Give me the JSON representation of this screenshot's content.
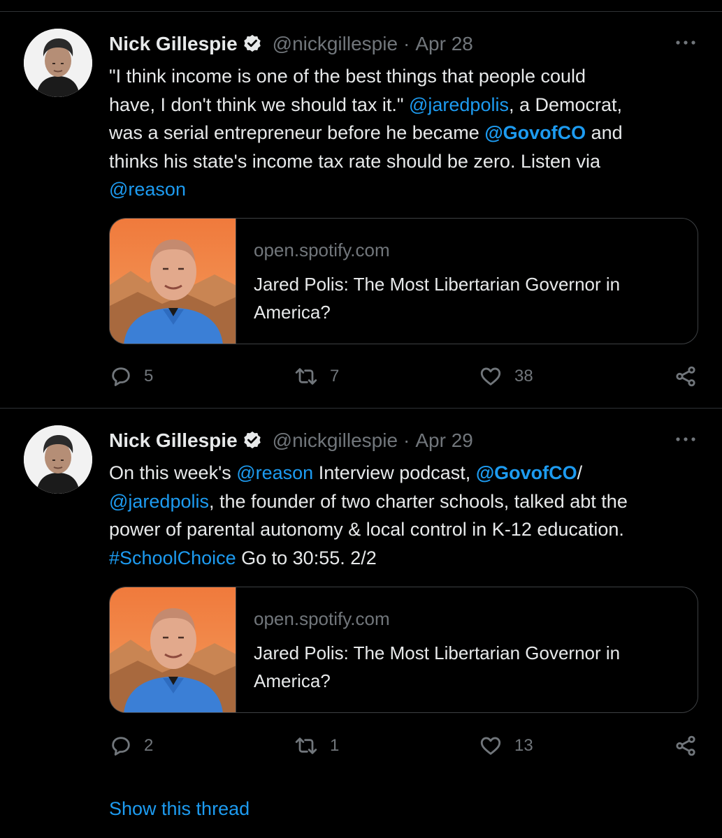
{
  "tweets": [
    {
      "author": "Nick Gillespie",
      "handle": "@nickgillespie",
      "separator": "·",
      "date": "Apr 28",
      "text_segments": [
        {
          "t": "\"I think income is one of the best things that people could",
          "k": "plain"
        },
        {
          "t": "have, I don't think we should tax it.\" ",
          "k": "plain"
        },
        {
          "t": "@jaredpolis",
          "k": "mention"
        },
        {
          "t": ", a Democrat,",
          "k": "plain"
        },
        {
          "t": "was a serial entrepreneur before he became ",
          "k": "plain"
        },
        {
          "t": "@GovofCO",
          "k": "mention-bold"
        },
        {
          "t": " and",
          "k": "plain"
        },
        {
          "t": "thinks his state's income tax rate should be zero. Listen via",
          "k": "plain"
        },
        {
          "t": "@reason",
          "k": "mention"
        }
      ],
      "card": {
        "domain": "open.spotify.com",
        "title": "Jared Polis: The Most Libertarian Governor in America?"
      },
      "counts": {
        "replies": "5",
        "retweets": "7",
        "likes": "38"
      }
    },
    {
      "author": "Nick Gillespie",
      "handle": "@nickgillespie",
      "separator": "·",
      "date": "Apr 29",
      "text_segments": [
        {
          "t": "On this week's ",
          "k": "plain"
        },
        {
          "t": "@reason",
          "k": "mention"
        },
        {
          "t": " Interview podcast, ",
          "k": "plain"
        },
        {
          "t": "@GovofCO",
          "k": "mention-bold"
        },
        {
          "t": "/",
          "k": "plain"
        },
        {
          "t": "@jaredpolis",
          "k": "mention"
        },
        {
          "t": ", the founder of two charter schools, talked abt the",
          "k": "plain"
        },
        {
          "t": "power of parental autonomy & local control in K-12 education.",
          "k": "plain"
        },
        {
          "t": "#SchoolChoice",
          "k": "mention"
        },
        {
          "t": " Go to 30:55. 2/2",
          "k": "plain"
        }
      ],
      "card": {
        "domain": "open.spotify.com",
        "title": "Jared Polis: The Most Libertarian Governor in America?"
      },
      "counts": {
        "replies": "2",
        "retweets": "1",
        "likes": "13"
      }
    }
  ],
  "thread": {
    "show_label": "Show this thread"
  },
  "icons": {
    "verified": "verified-badge-icon",
    "more": "more-options-icon",
    "reply": "reply-icon",
    "retweet": "retweet-icon",
    "like": "heart-icon",
    "share": "share-icon"
  },
  "colors": {
    "background": "#000000",
    "text": "#e7e9ea",
    "secondary": "#71767b",
    "link": "#1d9bf0",
    "divider": "#2f3336"
  }
}
